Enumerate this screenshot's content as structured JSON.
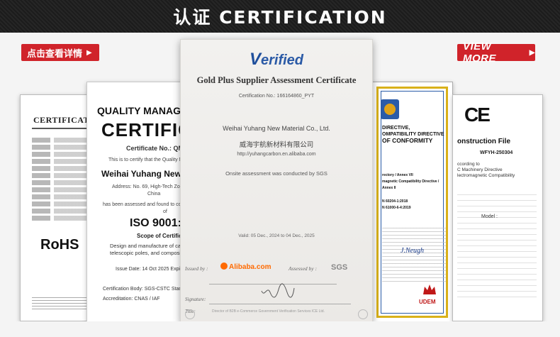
{
  "header": {
    "title": "认证  CERTIFICATION"
  },
  "buttons": {
    "details": {
      "label": "点击查看详情",
      "arrow": "▶"
    },
    "view_more": {
      "label": "VIEW MORE",
      "arrow": "▶"
    }
  },
  "cert_rohs": {
    "heading": "CERTIFICATI",
    "mark": "RoHS"
  },
  "cert_quality": {
    "heading": "QUALITY MANAGEM",
    "title": "CERTIFIC",
    "number": "Certificate No.: QMS-2",
    "certify_text": "This is to certify that the Quality Ma",
    "company": "Weihai Yuhang New Ma",
    "address_line1": "Address: No. 69, High-Tech Zone,",
    "address_line2": "China",
    "assessed_line1": "has been assessed and found to confi",
    "assessed_line2": "of",
    "standard": "ISO 9001:2",
    "scope_label": "Scope of Certifica",
    "scope_line1": "Design and manufacture of ca",
    "scope_line2": "telescopic poles, and composit",
    "issue_date": "Issue Date:   14 Oct 2025     Expi",
    "cert_body": "Certification Body:     SGS-CSTC Standards",
    "accreditation": "Accreditation:           CNAS / IAF"
  },
  "cert_verified": {
    "badge_v": "V",
    "badge_rest": "erified",
    "title": "Gold Plus Supplier Assessment Certificate",
    "certificate_no": "Certification No.: 166164860_PYT",
    "company_en": "Weihai Yuhang New Material Co., Ltd.",
    "company_cn": "威海宇航新材料有限公司",
    "url": "http://yuhangcarbon.en.alibaba.com",
    "onsite": "Onsite assessment was conducted by SGS",
    "valid": "Valid: 05 Dec., 2024 to 04 Dec., 2025",
    "issued_by": "Issued by :",
    "issuer": "Alibaba.com",
    "assessed_by": "Assessed by :",
    "assessor": "SGS",
    "signature_label": "Signature:",
    "title_label": "Title:",
    "director_text": "Director of B2B e-Commerce Government Verification Services ICE Ltd."
  },
  "cert_udem": {
    "lines": [
      "DIRECTIVE,",
      "OMPATIBILITY DIRECTIVE",
      "OF CONFORMITY",
      "",
      "rectory / Annex VII",
      "magnetic Compatibility Directive / Annex II",
      "",
      "N 60204-1:2018",
      "N 61000-6-4:2019"
    ],
    "brand": "UDEM",
    "signature": "J.Neugh"
  },
  "cert_ce": {
    "mark": "CE",
    "title": "onstruction File",
    "number": "WFYH-250304",
    "text_lines": [
      "ccording to",
      "C Machinery Directive",
      "lectromagnetic Compatibility"
    ],
    "model": "Model :"
  },
  "colors": {
    "accent_red": "#d0232a",
    "alibaba_orange": "#ff6a00",
    "verified_blue": "#2b5aa6",
    "udem_gold": "#d9b11a"
  }
}
